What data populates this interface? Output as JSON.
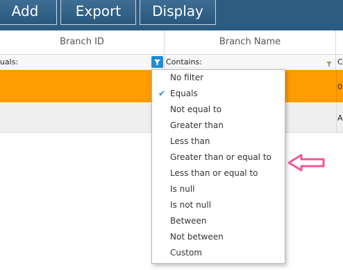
{
  "toolbar": {
    "add_label": "Add",
    "export_label": "Export",
    "display_label": "Display"
  },
  "grid": {
    "headers": [
      "Branch ID",
      "Branch Name"
    ],
    "filter_row": {
      "col0_operator": "Equals:",
      "col1_operator": "Contains:",
      "col2_fragment": "C"
    },
    "rows": [
      {
        "col2_fragment": "0"
      },
      {
        "col2_fragment": "A"
      }
    ]
  },
  "filter_menu": {
    "selected": "Equals",
    "items": [
      "No filter",
      "Equals",
      "Not equal to",
      "Greater than",
      "Less than",
      "Greater than or equal to",
      "Less than or equal to",
      "Is null",
      "Is not null",
      "Between",
      "Not between",
      "Custom"
    ]
  },
  "colors": {
    "toolbar": "#2c5c82",
    "selected_row": "#ff9c00",
    "filter_active": "#1f8bd6",
    "annotation_arrow": "#f0559a"
  },
  "icons": {
    "filter_active": "funnel-icon",
    "filter_idle": "funnel-icon",
    "selected_mark": "check-icon",
    "annotation": "arrow-left-icon"
  }
}
